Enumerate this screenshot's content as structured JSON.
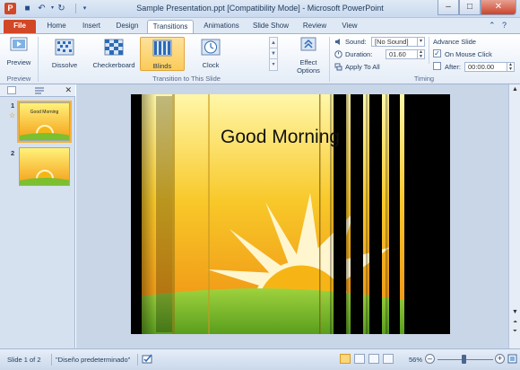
{
  "window": {
    "title": "Sample Presentation.ppt [Compatibility Mode] - Microsoft PowerPoint",
    "app_icon_letter": "P",
    "minimize_glyph": "–",
    "maximize_glyph": "□",
    "close_glyph": "✕"
  },
  "quick_access": {
    "save_glyph": "■",
    "undo_glyph": "↶",
    "redo_glyph": "↻",
    "customize_glyph": "▾"
  },
  "tabs": {
    "file": "File",
    "items": [
      "Home",
      "Insert",
      "Design",
      "Transitions",
      "Animations",
      "Slide Show",
      "Review",
      "View"
    ],
    "active": "Transitions"
  },
  "ribbon": {
    "preview": {
      "label": "Preview",
      "group": "Preview"
    },
    "transition_group": "Transition to This Slide",
    "gallery": [
      {
        "label": "Dissolve",
        "icon": "dissolve-icon"
      },
      {
        "label": "Checkerboard",
        "icon": "checkerboard-icon"
      },
      {
        "label": "Blinds",
        "icon": "blinds-icon",
        "selected": true
      },
      {
        "label": "Clock",
        "icon": "clock-icon"
      }
    ],
    "effect_options": "Effect Options",
    "timing_group": "Timing",
    "sound_label": "Sound:",
    "sound_value": "[No Sound]",
    "duration_label": "Duration:",
    "duration_value": "01.60",
    "apply_all": "Apply To All",
    "advance_title": "Advance Slide",
    "on_mouse_click": "On Mouse Click",
    "on_mouse_click_checked": true,
    "after_label": "After:",
    "after_value": "00:00.00",
    "after_checked": false
  },
  "slide_pane": {
    "thumbnails": [
      {
        "number": "1",
        "title": "Good Morning",
        "selected": true,
        "star": "☆"
      },
      {
        "number": "2",
        "title": "",
        "selected": false
      }
    ]
  },
  "slide": {
    "title": "Good Morning"
  },
  "status": {
    "slide_info": "Slide 1 of 2",
    "theme": "\"Diseño predeterminado\"",
    "zoom": "56%",
    "zoom_fraction": 0.56
  },
  "colors": {
    "file_tab": "#d24726",
    "selection": "#fbcb5a",
    "sun": "#f7b515",
    "grass": "#7cbf2f"
  }
}
